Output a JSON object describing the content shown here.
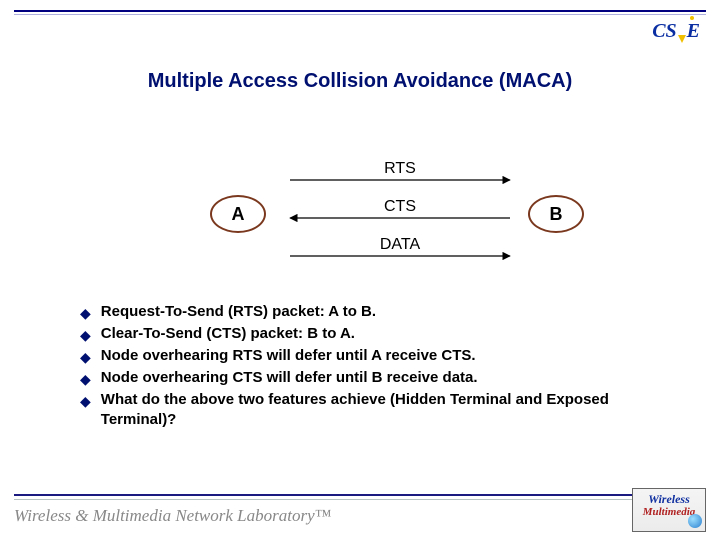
{
  "header": {
    "logo_cs": "CS",
    "logo_e": "E"
  },
  "title": "Multiple Access Collision Avoidance (MACA)",
  "diagram": {
    "node_a": "A",
    "node_b": "B",
    "label_rts": "RTS",
    "label_cts": "CTS",
    "label_data": "DATA"
  },
  "bullets": {
    "b1": "Request-To-Send (RTS) packet: A to B.",
    "b2": "Clear-To-Send (CTS) packet: B to A.",
    "b3": "Node  overhearing RTS will defer until A receive CTS.",
    "b4": "Node  overhearing CTS will defer until B receive data.",
    "b5": "What do the above two features achieve (Hidden Terminal and Exposed Terminal)?"
  },
  "footer": {
    "lab": "Wireless & Multimedia Network Laboratory™",
    "wm_line1": "Wireless",
    "wm_line2": "Multimedia"
  }
}
